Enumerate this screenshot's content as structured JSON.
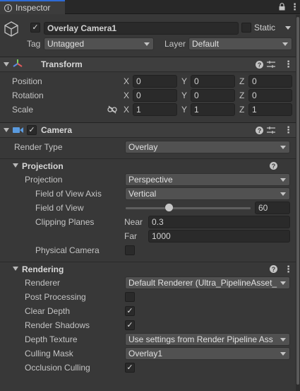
{
  "tab": {
    "title": "Inspector",
    "lock_icon": "lock-icon",
    "menu_icon": "kebab-menu-icon"
  },
  "object": {
    "icon": "cube-icon",
    "active": true,
    "name": "Overlay Camera1",
    "static_label": "Static",
    "static_checked": false,
    "tag_label": "Tag",
    "tag_value": "Untagged",
    "layer_label": "Layer",
    "layer_value": "Default"
  },
  "transform": {
    "title": "Transform",
    "icon": "transform-axes-icon",
    "position": {
      "label": "Position",
      "x": "0",
      "y": "0",
      "z": "0"
    },
    "rotation": {
      "label": "Rotation",
      "x": "0",
      "y": "0",
      "z": "0"
    },
    "scale": {
      "label": "Scale",
      "x": "1",
      "y": "1",
      "z": "1",
      "link_icon": "unlink-icon"
    },
    "axis": {
      "x": "X",
      "y": "Y",
      "z": "Z"
    }
  },
  "camera": {
    "title": "Camera",
    "icon": "video-camera-icon",
    "enabled": true,
    "render_type_label": "Render Type",
    "render_type_value": "Overlay"
  },
  "projection": {
    "title": "Projection",
    "projection_label": "Projection",
    "projection_value": "Perspective",
    "fov_axis_label": "Field of View Axis",
    "fov_axis_value": "Vertical",
    "fov_label": "Field of View",
    "fov_value": "60",
    "fov_fraction": 0.35,
    "clipping_label": "Clipping Planes",
    "near_label": "Near",
    "near_value": "0.3",
    "far_label": "Far",
    "far_value": "1000",
    "physical_label": "Physical Camera",
    "physical_checked": false
  },
  "rendering": {
    "title": "Rendering",
    "renderer_label": "Renderer",
    "renderer_value": "Default Renderer (Ultra_PipelineAsset_",
    "post_label": "Post Processing",
    "post_checked": false,
    "clear_depth_label": "Clear Depth",
    "clear_depth_checked": true,
    "shadows_label": "Render Shadows",
    "shadows_checked": true,
    "depth_tex_label": "Depth Texture",
    "depth_tex_value": "Use settings from Render Pipeline Ass",
    "culling_label": "Culling Mask",
    "culling_value": "Overlay1",
    "occlusion_label": "Occlusion Culling",
    "occlusion_checked": true
  },
  "colors": {
    "accent": "#2e6bd6",
    "panel": "#383838",
    "header": "#3e3e3e",
    "field": "#2a2a2a"
  }
}
